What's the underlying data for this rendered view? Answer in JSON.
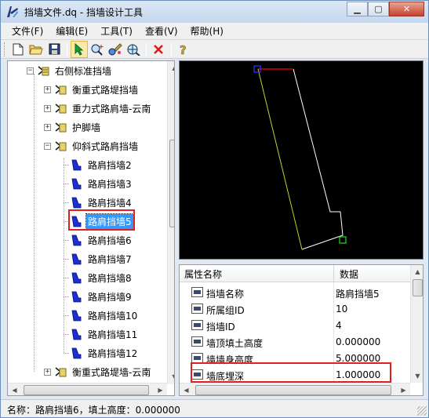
{
  "window": {
    "title": "挡墙文件.dq - 挡墙设计工具",
    "min_icon": "minimize-icon",
    "max_icon": "maximize-icon",
    "close_icon": "close-icon"
  },
  "menu": [
    "文件(F)",
    "编辑(E)",
    "工具(T)",
    "查看(V)",
    "帮助(H)"
  ],
  "toolbar": [
    "new-file-icon",
    "open-folder-icon",
    "save-icon",
    "select-arrow-icon",
    "zoom-point-icon",
    "paint-icon",
    "zoom-extent-icon",
    "delete-icon",
    "help-icon"
  ],
  "tree": {
    "root": "右侧标准挡墙",
    "groups": [
      {
        "label": "衡重式路堤挡墙",
        "expanded": false
      },
      {
        "label": "重力式路肩墙-云南",
        "expanded": false
      },
      {
        "label": "护脚墙",
        "expanded": false
      },
      {
        "label": "仰斜式路肩挡墙",
        "expanded": true
      }
    ],
    "items": [
      "路肩挡墙2",
      "路肩挡墙3",
      "路肩挡墙4",
      "路肩挡墙5",
      "路肩挡墙6",
      "路肩挡墙7",
      "路肩挡墙8",
      "路肩挡墙9",
      "路肩挡墙10",
      "路肩挡墙11",
      "路肩挡墙12"
    ],
    "selected_index": 3,
    "last_group": "衡重式路堤墙-云南"
  },
  "properties": {
    "col_name": "属性名称",
    "col_value": "数据",
    "rows": [
      {
        "name": "挡墙名称",
        "value": "路肩挡墙5"
      },
      {
        "name": "所属组ID",
        "value": "10"
      },
      {
        "name": "挡墙ID",
        "value": "4"
      },
      {
        "name": "墙顶填土高度",
        "value": "0.000000"
      },
      {
        "name": "墙墙身高度",
        "value": "5.000000"
      },
      {
        "name": "墙底埋深",
        "value": "1.000000"
      }
    ]
  },
  "status": "名称：路肩挡墙6，填土高度：0.000000",
  "colors": {
    "accent": "#e02020",
    "selection": "#3399ff",
    "canvas": "#000000",
    "wall_top": "#ff0000",
    "wall_left": "#cccc33"
  }
}
